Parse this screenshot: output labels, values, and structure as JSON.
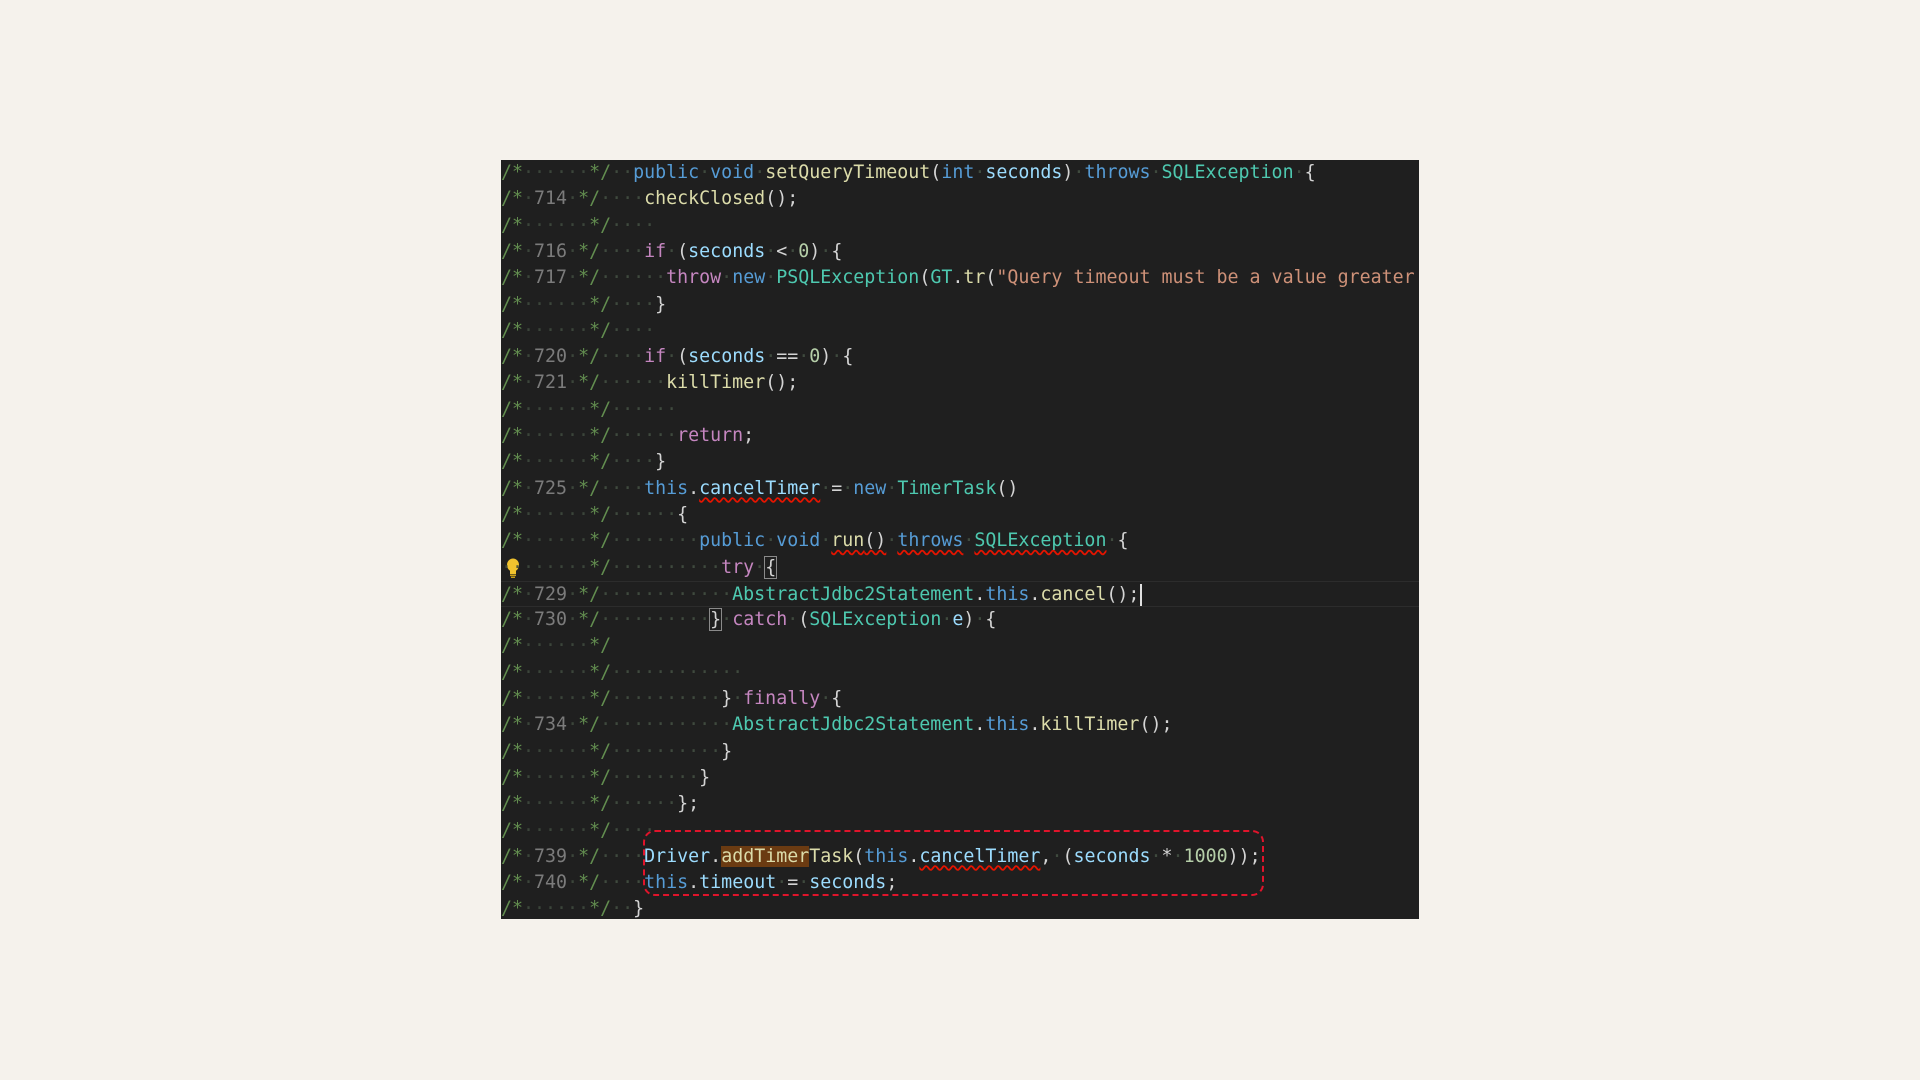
{
  "editor": {
    "gutter": {
      "comment_open": "/*",
      "comment_close": "*/",
      "line_numbers": [
        "714",
        "716",
        "717",
        "720",
        "721",
        "725",
        "729",
        "730",
        "734",
        "739",
        "740"
      ]
    },
    "code": {
      "method_signature": {
        "public": "public",
        "void": "void",
        "name": "setQueryTimeout",
        "param_type": "int",
        "param_name": "seconds",
        "throws": "throws",
        "exception": "SQLException"
      },
      "check_closed": "checkClosed",
      "if_kw": "if",
      "seconds_var": "seconds",
      "zero": "0",
      "throw_kw": "throw",
      "new_kw": "new",
      "psql_exception": "PSQLException",
      "gt_class": "GT",
      "tr_fn": "tr",
      "error_message": "\"Query timeout must be a value greater t",
      "kill_timer": "killTimer",
      "return_kw": "return",
      "this_kw": "this",
      "cancel_timer": "cancelTimer",
      "timer_task": "TimerTask",
      "run_fn": "run",
      "try_kw": "try",
      "abstract_stmt": "AbstractJdbc2Statement",
      "cancel_fn": "cancel",
      "catch_kw": "catch",
      "sql_exception": "SQLException",
      "e_var": "e",
      "finally_kw": "finally",
      "driver_class": "Driver",
      "add_timer_task_prefix": "add",
      "add_timer_task_hl": "addTimer",
      "add_timer_task_suffix": "Task",
      "thousand": "1000",
      "timeout_field": "timeout"
    }
  },
  "icons": {
    "lightbulb": "lightbulb-icon"
  },
  "colors": {
    "editor_bg": "#1f1f1f",
    "page_bg": "#f5f2ec",
    "annotation_red": "#e0142b",
    "keyword_blue": "#569cd6",
    "control_purple": "#c586c0",
    "type_teal": "#4ec9b0",
    "function_yellow": "#dcdcaa",
    "string_orange": "#ce9178"
  }
}
